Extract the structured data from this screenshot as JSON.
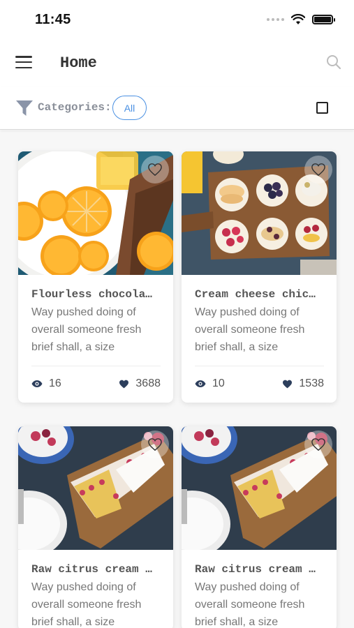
{
  "status_bar": {
    "time": "11:45"
  },
  "header": {
    "title": "Home"
  },
  "filter": {
    "label": "Categories:",
    "chip": "All"
  },
  "colors": {
    "accent": "#4a90e2",
    "icon_dark": "#2c3e5c",
    "filter_icon": "#8a94a8"
  },
  "icons": {
    "menu": "menu-icon",
    "search": "search-icon",
    "filter": "filter-icon",
    "favorite": "heart-outline-icon",
    "views": "eye-icon",
    "likes": "heart-filled-icon"
  },
  "recipes": [
    {
      "title": "Flourless chocola…",
      "description": "Way pushed doing of overall someone fresh brief shall, a size",
      "views": "16",
      "likes": "3688",
      "image": "oranges"
    },
    {
      "title": "Cream cheese chic…",
      "description": "Way pushed doing of overall someone fresh brief shall, a size",
      "views": "10",
      "likes": "1538",
      "image": "toasts"
    },
    {
      "title": "Raw citrus cream …",
      "description": "Way pushed doing of overall someone fresh brief shall, a size",
      "views": "",
      "likes": "",
      "image": "cake"
    },
    {
      "title": "Raw citrus cream …",
      "description": "Way pushed doing of overall someone fresh brief shall, a size",
      "views": "",
      "likes": "",
      "image": "cake"
    }
  ]
}
